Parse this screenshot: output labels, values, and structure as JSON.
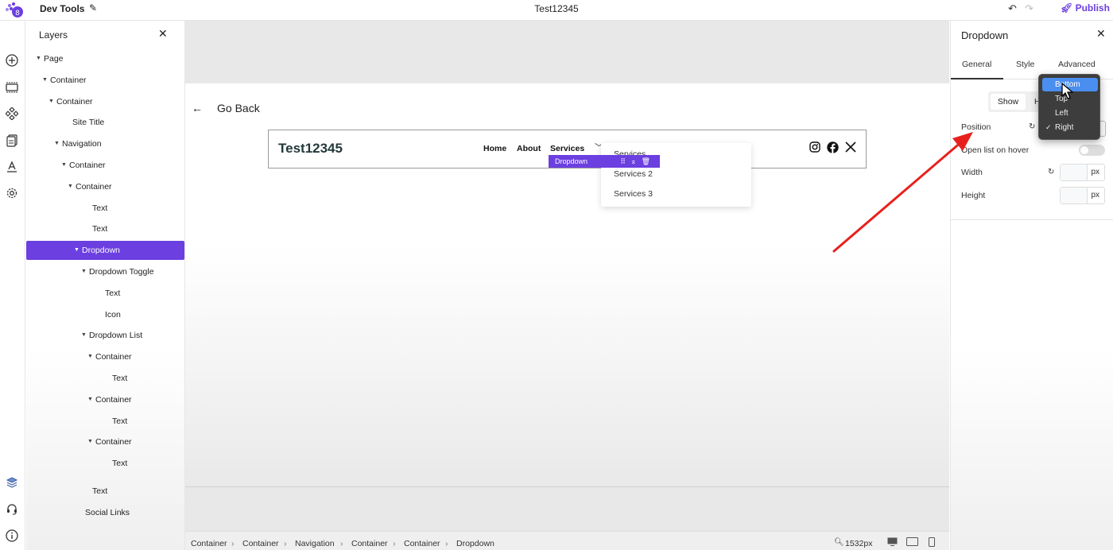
{
  "topbar": {
    "app_title": "Dev Tools",
    "doc_title": "Test12345",
    "publish_label": "Publish"
  },
  "rail": {
    "icons": [
      "add-icon",
      "section-icon",
      "components-icon",
      "pages-icon",
      "typography-icon",
      "settings-icon",
      "layers-icon",
      "support-icon",
      "info-icon"
    ]
  },
  "layers": {
    "title": "Layers",
    "items": [
      {
        "label": "Page",
        "caret": true
      },
      {
        "label": "Container",
        "caret": true
      },
      {
        "label": "Container",
        "caret": true
      },
      {
        "label": "Site Title",
        "caret": false
      },
      {
        "label": "Navigation",
        "caret": true
      },
      {
        "label": "Container",
        "caret": true
      },
      {
        "label": "Container",
        "caret": true
      },
      {
        "label": "Text",
        "caret": false
      },
      {
        "label": "Text",
        "caret": false
      },
      {
        "label": "Dropdown",
        "caret": true,
        "selected": true
      },
      {
        "label": "Dropdown Toggle",
        "caret": true
      },
      {
        "label": "Text",
        "caret": false
      },
      {
        "label": "Icon",
        "caret": false
      },
      {
        "label": "Dropdown List",
        "caret": true
      },
      {
        "label": "Container",
        "caret": true
      },
      {
        "label": "Text",
        "caret": false
      },
      {
        "label": "Container",
        "caret": true
      },
      {
        "label": "Text",
        "caret": false
      },
      {
        "label": "Container",
        "caret": true
      },
      {
        "label": "Text",
        "caret": false
      },
      {
        "label": "Text",
        "caret": false
      },
      {
        "label": "Social Links",
        "caret": false
      }
    ]
  },
  "canvas": {
    "go_back": "Go Back",
    "site_title": "Test12345",
    "nav_links": [
      "Home",
      "About",
      "Services"
    ],
    "dropdown_items": [
      "Services",
      "Services 2",
      "Services 3"
    ],
    "selected_badge": "Dropdown",
    "social_icons": [
      "instagram-icon",
      "facebook-icon",
      "x-icon"
    ]
  },
  "breadcrumb": {
    "items": [
      "Container",
      "Container",
      "Navigation",
      "Container",
      "Container",
      "Dropdown"
    ],
    "zoom": "1532px"
  },
  "props": {
    "title": "Dropdown",
    "tabs": [
      "General",
      "Style",
      "Advanced"
    ],
    "active_tab": "General",
    "visibility": {
      "show": "Show",
      "hide": "H"
    },
    "position_label": "Position",
    "hover_label": "Open list on hover",
    "hover_enabled": false,
    "width_label": "Width",
    "height_label": "Height",
    "unit": "px"
  },
  "position_menu": {
    "options": [
      "Bottom",
      "Top",
      "Left",
      "Right"
    ],
    "highlighted": "Bottom",
    "checked": "Right"
  },
  "colors": {
    "accent": "#6b3fe0",
    "menu_highlight": "#4a8ef0",
    "arrow": "#e8201c"
  }
}
